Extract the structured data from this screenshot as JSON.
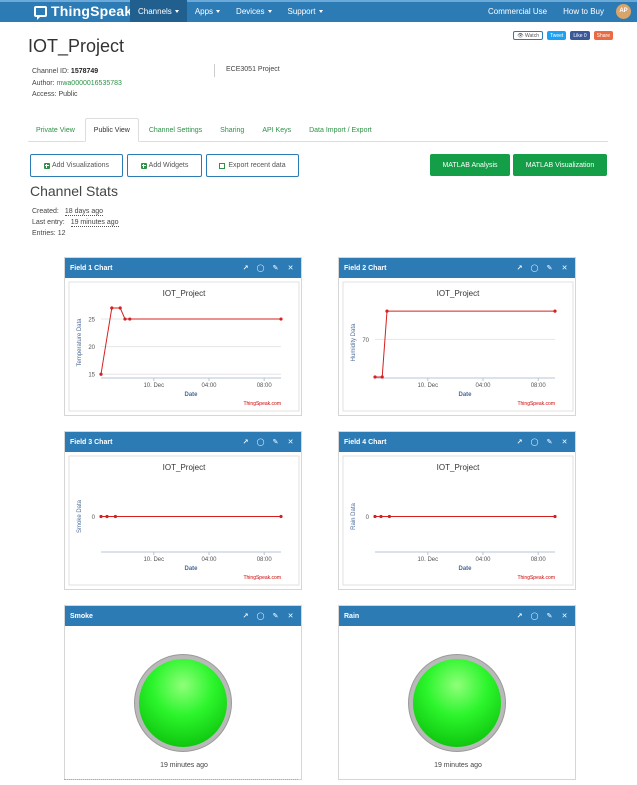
{
  "nav": {
    "brand": "ThingSpeak",
    "trademark": "™",
    "items": [
      {
        "label": "Channels",
        "active": true
      },
      {
        "label": "Apps",
        "active": false
      },
      {
        "label": "Devices",
        "active": false
      },
      {
        "label": "Support",
        "active": false
      }
    ],
    "right": [
      "Commercial Use",
      "How to Buy"
    ],
    "avatar": "AP"
  },
  "social": {
    "watch": "Watch",
    "tweet": "Tweet",
    "like": "Like 0",
    "share": "Share"
  },
  "channel": {
    "title": "IOT_Project",
    "id_label": "Channel ID:",
    "id": "1578749",
    "author_label": "Author:",
    "author": "mwa0000016535783",
    "access_label": "Access:",
    "access": "Public",
    "description": "ECE3051 Project"
  },
  "tabs": [
    "Private View",
    "Public View",
    "Channel Settings",
    "Sharing",
    "API Keys",
    "Data Import / Export"
  ],
  "active_tab": "Public View",
  "buttons": {
    "add_visualizations": "Add Visualizations",
    "add_widgets": "Add Widgets",
    "export": "Export recent data",
    "matlab_analysis": "MATLAB Analysis",
    "matlab_visualization": "MATLAB Visualization"
  },
  "stats": {
    "title": "Channel Stats",
    "created_label": "Created:",
    "created": "18 days ago",
    "last_entry_label": "Last entry:",
    "last_entry": "19 minutes ago",
    "entries_label": "Entries:",
    "entries": "12"
  },
  "chart_data": [
    {
      "type": "line",
      "panel": "Field 1 Chart",
      "title": "IOT_Project",
      "xlabel": "Date",
      "ylabel": "Temperature Data",
      "credit": "ThingSpeak.com",
      "xticks": [
        "10. Dec",
        "04:00",
        "08:00"
      ],
      "yticks": [
        15,
        20,
        25
      ],
      "ylim": [
        14.5,
        27
      ],
      "color": "#d62020",
      "x": [
        0,
        0.9,
        1.6,
        2.0,
        2.4,
        15
      ],
      "y": [
        15,
        27,
        27,
        25,
        25,
        25
      ]
    },
    {
      "type": "line",
      "panel": "Field 2 Chart",
      "title": "IOT_Project",
      "xlabel": "Date",
      "ylabel": "Humidity Data",
      "credit": "ThingSpeak.com",
      "xticks": [
        "10. Dec",
        "04:00",
        "08:00"
      ],
      "yticks": [
        70
      ],
      "ylim": [
        58,
        80
      ],
      "color": "#d62020",
      "x": [
        0,
        0.6,
        1.0,
        15
      ],
      "y": [
        58,
        58,
        79,
        79
      ]
    },
    {
      "type": "line",
      "panel": "Field 3 Chart",
      "title": "IOT_Project",
      "xlabel": "Date",
      "ylabel": "Smoke Data",
      "credit": "ThingSpeak.com",
      "xticks": [
        "10. Dec",
        "04:00",
        "08:00"
      ],
      "yticks": [
        0
      ],
      "ylim": [
        -1,
        1
      ],
      "color": "#d62020",
      "x": [
        0,
        0.5,
        1.2,
        15
      ],
      "y": [
        0,
        0,
        0,
        0
      ]
    },
    {
      "type": "line",
      "panel": "Field 4 Chart",
      "title": "IOT_Project",
      "xlabel": "Date",
      "ylabel": "Rain Data",
      "credit": "ThingSpeak.com",
      "xticks": [
        "10. Dec",
        "04:00",
        "08:00"
      ],
      "yticks": [
        0
      ],
      "ylim": [
        -1,
        1
      ],
      "color": "#d62020",
      "x": [
        0,
        0.5,
        1.2,
        15
      ],
      "y": [
        0,
        0,
        0,
        0
      ]
    }
  ],
  "lamps": [
    {
      "title": "Smoke",
      "time": "19 minutes ago",
      "color": "#22ee22"
    },
    {
      "title": "Rain",
      "time": "19 minutes ago",
      "color": "#22ee22"
    }
  ]
}
